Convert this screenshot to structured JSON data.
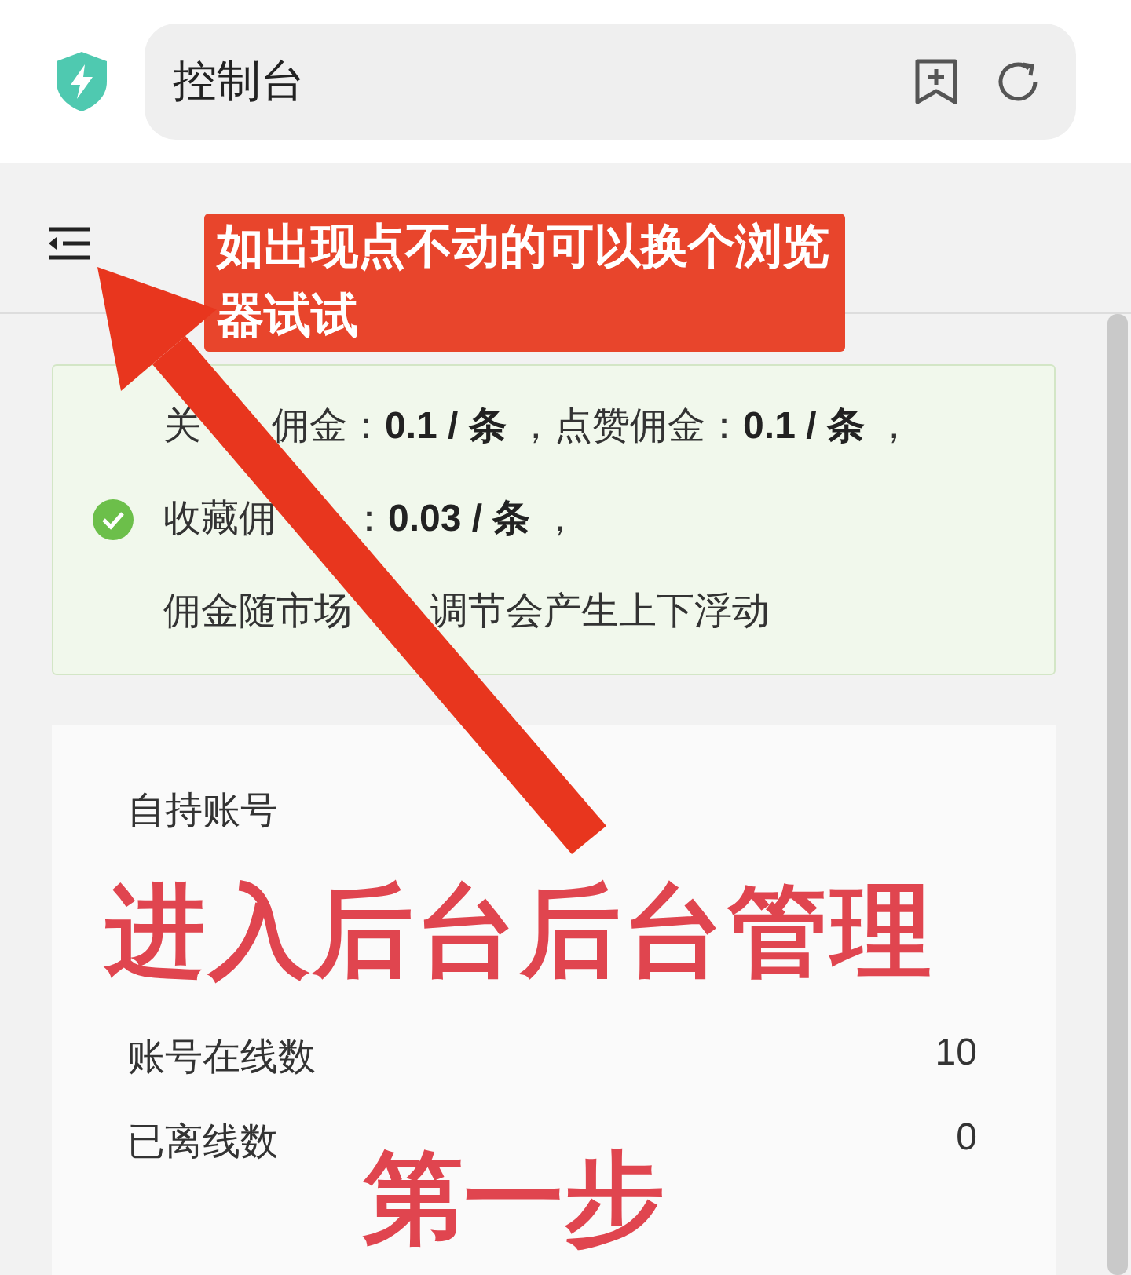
{
  "browser": {
    "address": "控制台"
  },
  "annotation": {
    "label": "如出现点不动的可以换个浏览器试试"
  },
  "notice": {
    "lines": [
      {
        "segments": [
          "关",
          "佣金：**0.1 / 条** ，点赞佣金：**0.1 / 条** ，"
        ]
      },
      {
        "segments": [
          "收藏佣",
          "：**0.03 / 条** ，"
        ]
      },
      {
        "segments": [
          "佣金随市场",
          "调节会产生上下浮动"
        ]
      }
    ]
  },
  "account": {
    "title": "自持账号",
    "stats": [
      {
        "label": "账号在线数",
        "value": "10"
      },
      {
        "label": "已离线数",
        "value": "0"
      }
    ]
  },
  "overlay_texts": {
    "headline": "进入后台后台管理",
    "step": "第一步"
  }
}
